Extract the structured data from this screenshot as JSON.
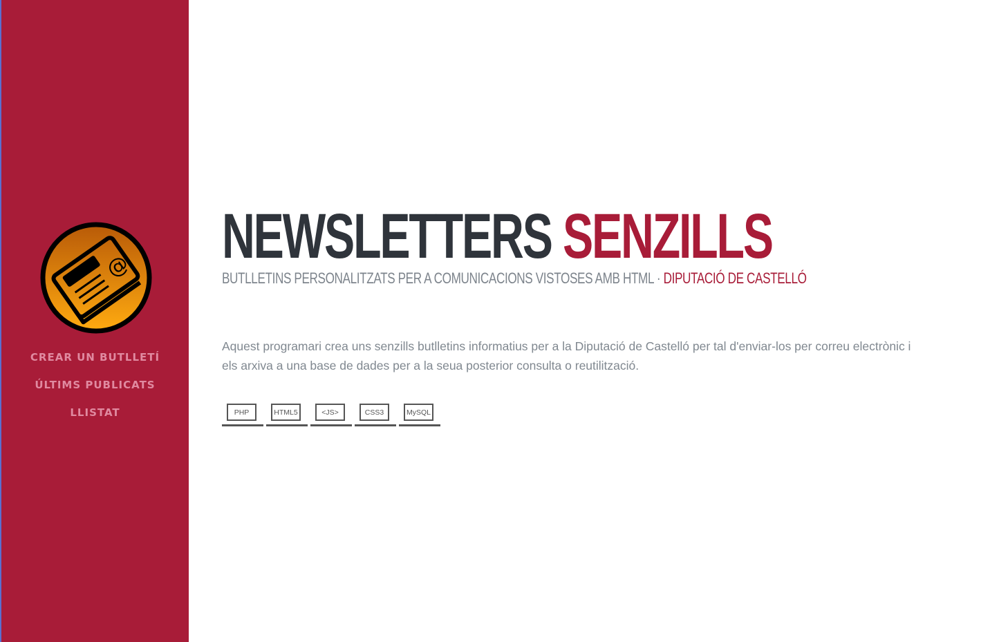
{
  "sidebar": {
    "nav": [
      {
        "label": "CREAR UN BUTLLETÍ"
      },
      {
        "label": "ÚLTIMS PUBLICATS"
      },
      {
        "label": "LLISTAT"
      }
    ],
    "colors": {
      "background": "#a81c38",
      "link": "#e08aa0"
    },
    "logo_icon": "newsletter-at-icon"
  },
  "header": {
    "title_dark": "NEWSLETTERS",
    "title_red": "SENZILLS",
    "subtitle_main": "BUTLLETINS PERSONALITZATS PER A COMUNICACIONS VISTOSES AMB HTML ·",
    "subtitle_red": "DIPUTACIÓ DE CASTELLÓ"
  },
  "description": "Aquest programari crea uns senzills butlletins informatius per a la Diputació de Castelló per tal d'enviar-los per correu electrònic i els arxiva a una base de dades per a la seua posterior consulta o reutilització.",
  "badges": [
    {
      "label": "PHP"
    },
    {
      "label": "HTML5"
    },
    {
      "label": "<JS>"
    },
    {
      "label": "CSS3"
    },
    {
      "label": "MySQL"
    }
  ]
}
